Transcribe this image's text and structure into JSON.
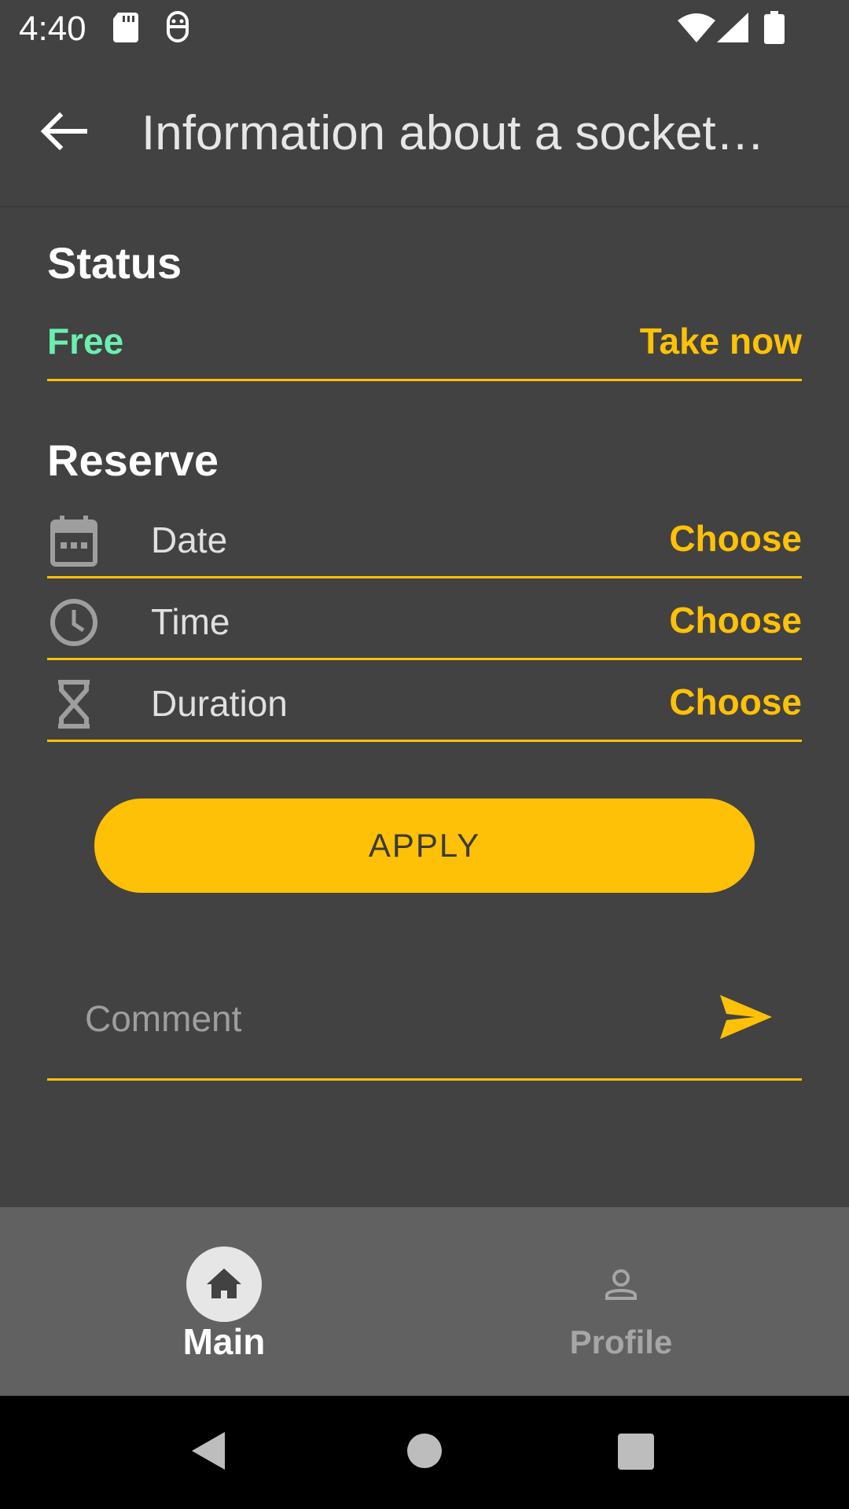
{
  "status_bar": {
    "time": "4:40",
    "icons": [
      "sd-card-icon",
      "robot-face-icon",
      "wifi-icon",
      "cellular-signal-icon",
      "battery-icon"
    ]
  },
  "app_bar": {
    "title": "Information about a socket…",
    "back_icon": "arrow-back-icon"
  },
  "status_section": {
    "title": "Status",
    "value": "Free",
    "action": "Take now"
  },
  "reserve_section": {
    "title": "Reserve",
    "rows": [
      {
        "icon": "calendar-icon",
        "label": "Date",
        "action": "Choose"
      },
      {
        "icon": "clock-icon",
        "label": "Time",
        "action": "Choose"
      },
      {
        "icon": "hourglass-icon",
        "label": "Duration",
        "action": "Choose"
      }
    ],
    "apply_label": "APPLY"
  },
  "comment": {
    "placeholder": "Comment",
    "send_icon": "send-icon"
  },
  "bottom_nav": {
    "items": [
      {
        "label": "Main",
        "icon": "home-icon",
        "selected": true
      },
      {
        "label": "Profile",
        "icon": "person-icon",
        "selected": false
      }
    ]
  },
  "colors": {
    "background": "#424242",
    "accent": "#FFC107",
    "status_free": "#69F0AE",
    "bottom_nav": "#616161"
  }
}
